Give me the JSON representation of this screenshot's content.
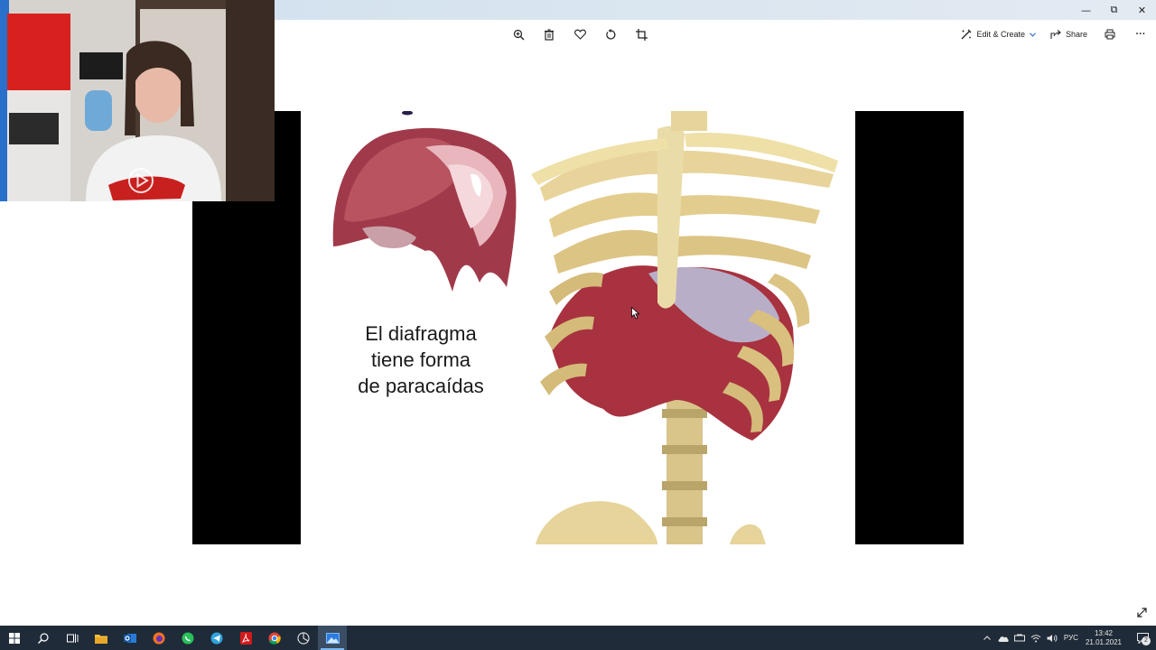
{
  "window": {
    "controls": {
      "minimize": "—",
      "maximize": "⧉",
      "close": "✕"
    }
  },
  "toolbar": {
    "icons": [
      "zoom-in-icon",
      "delete-icon",
      "heart-icon",
      "rotate-icon",
      "crop-icon"
    ],
    "edit_create_label": "Edit & Create",
    "share_label": "Share",
    "more_label": "···"
  },
  "slide": {
    "caption_lines": [
      "El diafragma",
      "tiene forma",
      "de paracaídas"
    ]
  },
  "taskbar": {
    "apps": [
      "windows-start",
      "search",
      "task-view",
      "file-explorer",
      "outlook",
      "firefox",
      "whatsapp",
      "telegram",
      "acrobat",
      "chrome",
      "app-circle",
      "photos"
    ],
    "language": "РУС",
    "time": "13:42",
    "date": "21.01.2021",
    "notification_count": "2"
  },
  "colors": {
    "taskbar_bg": "#1f2b38",
    "titlebar_bg": "#dbe6f0",
    "letterbox": "#000000",
    "accent": "#79b8f2"
  }
}
